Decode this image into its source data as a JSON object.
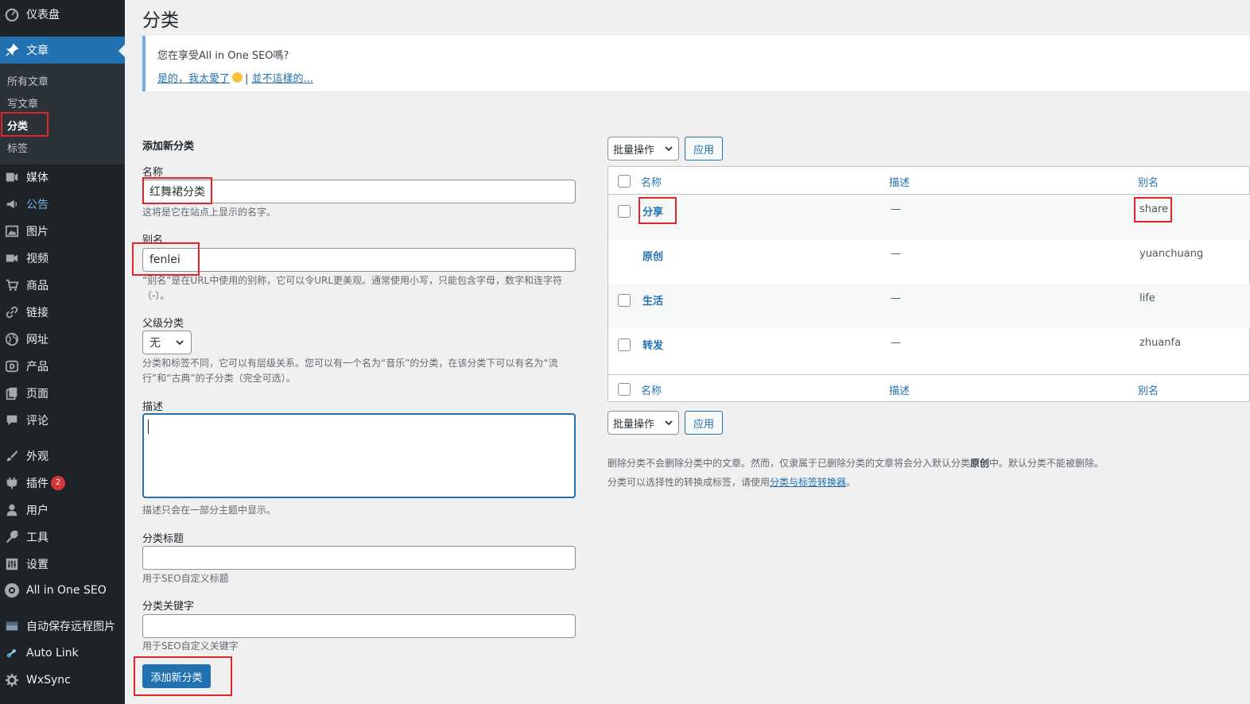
{
  "sidebar": {
    "dashboard": "仪表盘",
    "posts": "文章",
    "submenu": [
      "所有文章",
      "写文章",
      "分类",
      "标签"
    ],
    "items": [
      "媒体",
      "公告",
      "图片",
      "视频",
      "商品",
      "链接",
      "网址",
      "产品",
      "页面",
      "评论",
      "外观",
      "插件",
      "用户",
      "工具",
      "设置",
      "All in One SEO",
      "自动保存远程图片",
      "Auto Link",
      "WxSync"
    ],
    "plugins_badge": "2"
  },
  "page": {
    "title": "分类"
  },
  "notice": {
    "question": "您在享受All in One SEO嗎?",
    "yes_link": "是的，我太愛了",
    "separator": "|",
    "no_link": "並不這樣的..."
  },
  "form": {
    "heading": "添加新分类",
    "name_label": "名称",
    "name_value": "红舞裙分类",
    "name_help": "这将是它在站点上显示的名字。",
    "slug_label": "别名",
    "slug_value": "fenlei",
    "slug_help": "“别名”是在URL中使用的别称，它可以令URL更美观。通常使用小写，只能包含字母，数字和连字符（-）。",
    "parent_label": "父级分类",
    "parent_value": "无",
    "parent_help": "分类和标签不同，它可以有层级关系。您可以有一个名为“音乐”的分类，在该分类下可以有名为“流行”和“古典”的子分类（完全可选）。",
    "desc_label": "描述",
    "desc_help": "描述只会在一部分主题中显示。",
    "seo_title_label": "分类标题",
    "seo_title_help": "用于SEO自定义标题",
    "seo_kw_label": "分类关键字",
    "seo_kw_help": "用于SEO自定义关键字",
    "submit": "添加新分类"
  },
  "list": {
    "bulk_label": "批量操作",
    "apply_label": "应用",
    "col_name": "名称",
    "col_desc": "描述",
    "col_slug": "别名",
    "rows": [
      {
        "name": "分享",
        "desc": "—",
        "slug": "share"
      },
      {
        "name": "原创",
        "desc": "—",
        "slug": "yuanchuang"
      },
      {
        "name": "生活",
        "desc": "—",
        "slug": "life"
      },
      {
        "name": "转发",
        "desc": "—",
        "slug": "zhuanfa"
      }
    ],
    "note1_a": "删除分类不会删除分类中的文章。然而，仅隶属于已删除分类的文章将会分入默认分类",
    "note1_b": "原创",
    "note1_c": "中。默认分类不能被删除。",
    "note2_a": "分类可以选择性的转换成标签，请使用",
    "note2_link": "分类与标签转换器",
    "note2_b": "。"
  }
}
